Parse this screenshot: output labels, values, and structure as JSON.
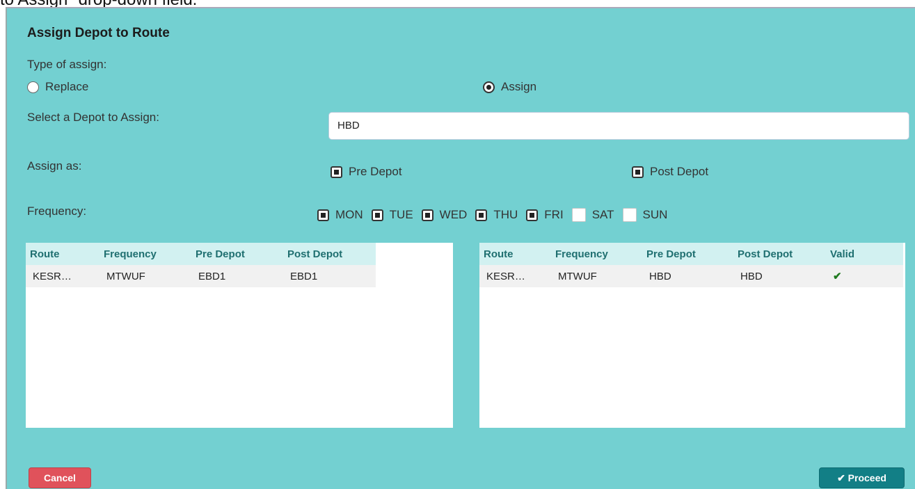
{
  "caption": "to Assign\" drop-down field.",
  "dialog": {
    "title": "Assign Depot to Route",
    "type_label": "Type of assign:",
    "radio_replace": "Replace",
    "radio_assign": "Assign",
    "selected_type": "Assign",
    "select_depot_label": "Select a Depot to Assign:",
    "depot_value": "HBD",
    "assign_as_label": "Assign as:",
    "pre_depot": "Pre Depot",
    "post_depot": "Post Depot",
    "frequency_label": "Frequency:",
    "days": [
      {
        "label": "MON",
        "checked": true
      },
      {
        "label": "TUE",
        "checked": true
      },
      {
        "label": "WED",
        "checked": true
      },
      {
        "label": "THU",
        "checked": true
      },
      {
        "label": "FRI",
        "checked": true
      },
      {
        "label": "SAT",
        "checked": false
      },
      {
        "label": "SUN",
        "checked": false
      }
    ],
    "left_table": {
      "headers": [
        "Route",
        "Frequency",
        "Pre Depot",
        "Post Depot"
      ],
      "rows": [
        [
          "KESR…",
          "MTWUF",
          "EBD1",
          "EBD1"
        ]
      ]
    },
    "right_table": {
      "headers": [
        "Route",
        "Frequency",
        "Pre Depot",
        "Post Depot",
        "Valid"
      ],
      "rows": [
        [
          "KESR…",
          "MTWUF",
          "HBD",
          "HBD",
          "✔"
        ]
      ]
    },
    "cancel_label": "Cancel",
    "proceed_label": "✔ Proceed"
  },
  "colors": {
    "dialog_bg": "#73d0d1",
    "cancel": "#e0525b",
    "proceed": "#127f86",
    "header": "#1f6f70"
  }
}
